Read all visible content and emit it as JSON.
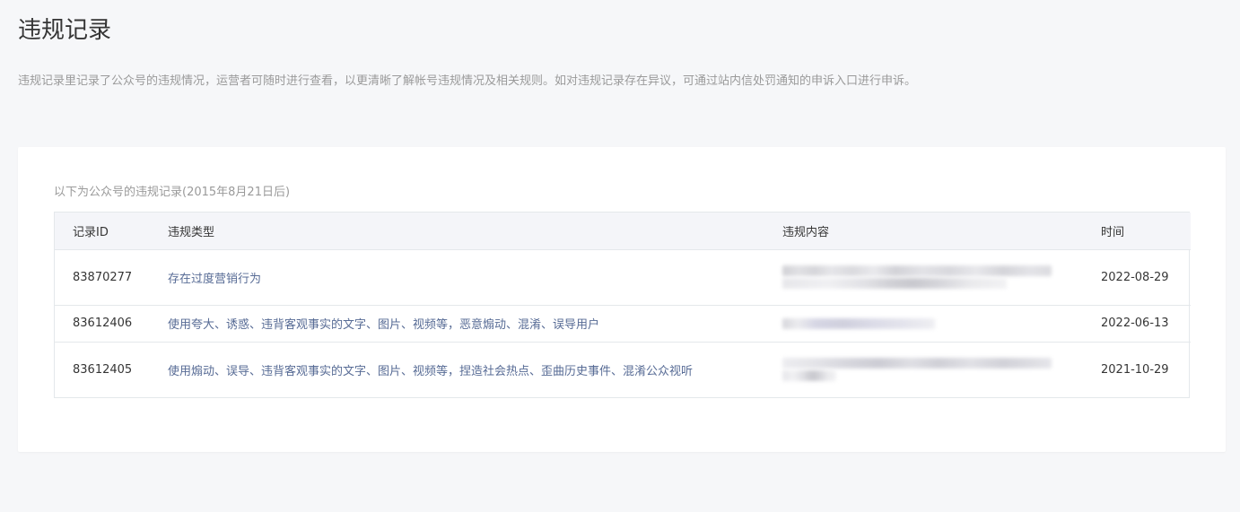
{
  "page": {
    "title": "违规记录",
    "description": "违规记录里记录了公众号的违规情况，运营者可随时进行查看，以更清晰了解帐号违规情况及相关规则。如对违规记录存在异议，可通过站内信处罚通知的申诉入口进行申诉。"
  },
  "records": {
    "caption": "以下为公众号的违规记录(2015年8月21日后)",
    "columns": {
      "id": "记录ID",
      "type": "违规类型",
      "content": "违规内容",
      "time": "时间"
    },
    "rows": [
      {
        "id": "83870277",
        "type": "存在过度营销行为",
        "content_blurred": true,
        "time": "2022-08-29"
      },
      {
        "id": "83612406",
        "type": "使用夸大、诱惑、违背客观事实的文字、图片、视频等，恶意煽动、混淆、误导用户",
        "content_blurred": true,
        "time": "2022-06-13"
      },
      {
        "id": "83612405",
        "type": "使用煽动、误导、违背客观事实的文字、图片、视频等，捏造社会热点、歪曲历史事件、混淆公众视听",
        "content_blurred": true,
        "time": "2021-10-29"
      }
    ]
  },
  "colors": {
    "background": "#f6f7f9",
    "card": "#ffffff",
    "link": "#576b95",
    "muted_text": "#9a9a9a",
    "header_row": "#f4f5f9",
    "border": "#e4e8eb"
  }
}
